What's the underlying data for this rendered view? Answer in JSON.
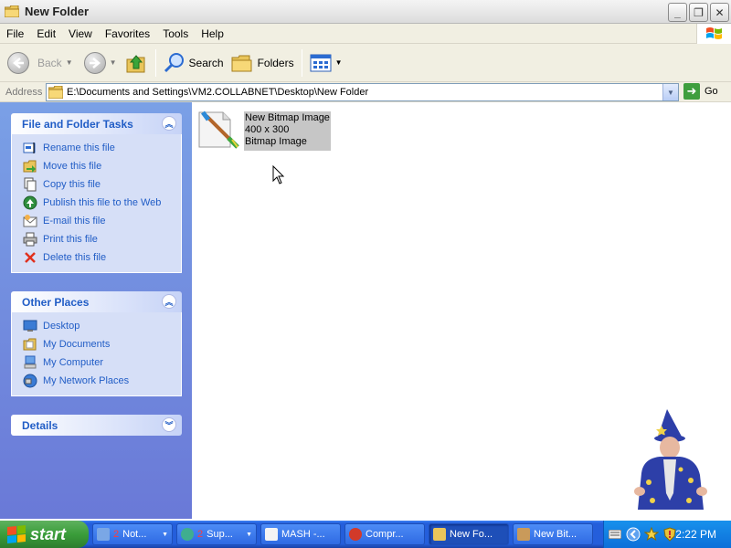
{
  "window": {
    "title": "New Folder",
    "buttons": {
      "minimize": "_",
      "maximize": "❐",
      "close": "✕"
    }
  },
  "menubar": {
    "items": [
      "File",
      "Edit",
      "View",
      "Favorites",
      "Tools",
      "Help"
    ]
  },
  "toolbar": {
    "back_label": "Back",
    "search_label": "Search",
    "folders_label": "Folders"
  },
  "addressbar": {
    "label": "Address",
    "path": "E:\\Documents and Settings\\VM2.COLLABNET\\Desktop\\New Folder",
    "go_label": "Go"
  },
  "taskpane": {
    "file_tasks": {
      "title": "File and Folder Tasks",
      "items": [
        "Rename this file",
        "Move this file",
        "Copy this file",
        "Publish this file to the Web",
        "E-mail this file",
        "Print this file",
        "Delete this file"
      ]
    },
    "other_places": {
      "title": "Other Places",
      "items": [
        "Desktop",
        "My Documents",
        "My Computer",
        "My Network Places"
      ]
    },
    "details": {
      "title": "Details"
    }
  },
  "content": {
    "file": {
      "name": "New Bitmap Image",
      "dimensions": "400 x 300",
      "type": "Bitmap Image"
    }
  },
  "taskbar": {
    "start_label": "start",
    "buttons": [
      {
        "count": "2",
        "label": "Not..."
      },
      {
        "count": "2",
        "label": "Sup..."
      },
      {
        "count": "",
        "label": "MASH -..."
      },
      {
        "count": "",
        "label": "Compr..."
      },
      {
        "count": "",
        "label": "New Fo..."
      },
      {
        "count": "",
        "label": "New Bit..."
      }
    ],
    "clock": "2:22 PM"
  },
  "colors": {
    "taskpane_link": "#215dc6",
    "taskbar_blue": "#245edb",
    "start_green": "#3a9d3a",
    "tray_blue": "#0d6fd9"
  }
}
